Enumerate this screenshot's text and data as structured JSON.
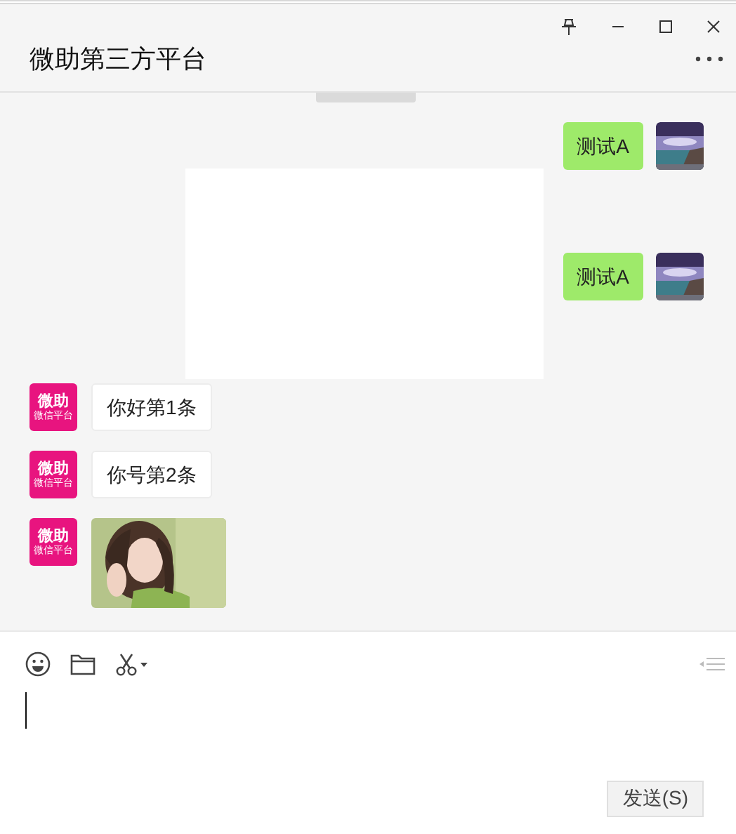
{
  "window": {
    "title": "微助第三方平台"
  },
  "messages": [
    {
      "kind": "text",
      "outgoing": true,
      "text": "测试A"
    },
    {
      "kind": "text",
      "outgoing": true,
      "text": "测试A"
    },
    {
      "kind": "text",
      "outgoing": false,
      "text": "你好第1条",
      "avatar": {
        "kind": "logo",
        "line_1": "微助",
        "line_2": "微信平台"
      }
    },
    {
      "kind": "text",
      "outgoing": false,
      "text": "你号第2条",
      "avatar": {
        "kind": "logo",
        "line_1": "微助",
        "line_2": "微信平台"
      }
    },
    {
      "kind": "picture",
      "outgoing": false,
      "avatar": {
        "kind": "logo",
        "line_1": "微助",
        "line_2": "微信平台"
      }
    }
  ],
  "composer": {
    "send_button": "发送(S)"
  }
}
